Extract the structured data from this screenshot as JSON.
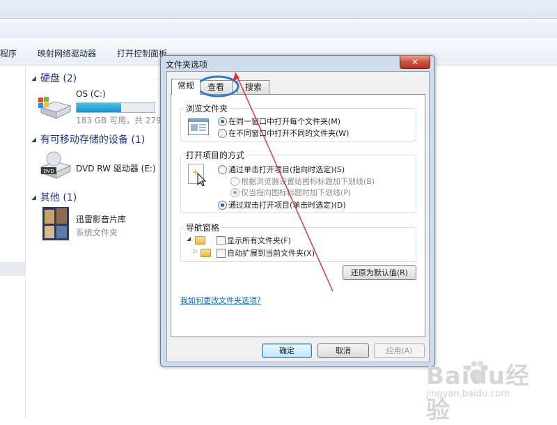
{
  "toolbar": {
    "item1": "程序",
    "item2": "映射网络驱动器",
    "item3": "打开控制面板"
  },
  "groups": {
    "hdd": {
      "label": "硬盘 (2)"
    },
    "removable": {
      "label": "有可移动存储的设备 (1)"
    },
    "other": {
      "label": "其他 (1)"
    }
  },
  "drives": {
    "os": {
      "name": "OS (C:)",
      "usage": "183 GB 可用，共 279",
      "fill_percent": 57
    },
    "dvd": {
      "name": "DVD RW 驱动器 (E:)",
      "icon_label": "DVD"
    },
    "media": {
      "name": "迅雷影音片库",
      "type": "系统文件夹"
    }
  },
  "dialog": {
    "title": "文件夹选项",
    "close": "✕",
    "tabs": [
      "常规",
      "查看",
      "搜索"
    ],
    "browse": {
      "legend": "浏览文件夹",
      "opt1": "在同一窗口中打开每个文件夹(M)",
      "opt2": "在不同窗口中打开不同的文件夹(W)"
    },
    "open": {
      "legend": "打开项目的方式",
      "opt1": "通过单击打开项目(指向时选定)(S)",
      "sub1": "根据浏览器设置给图标标题加下划线(B)",
      "sub2": "仅当指向图标标题时加下划线(P)",
      "opt2": "通过双击打开项目(单击时选定)(D)"
    },
    "nav": {
      "legend": "导航窗格",
      "chk1": "显示所有文件夹(F)",
      "chk2": "自动扩展到当前文件夹(X)"
    },
    "restore_btn": "还原为默认值(R)",
    "help_link": "我如何更改文件夹选项?",
    "ok_btn": "确定",
    "cancel_btn": "取消",
    "apply_btn": "应用(A)"
  },
  "watermark": {
    "brand": "Baidu经验",
    "url": "jingyan.baidu.com"
  },
  "colors": {
    "annotation_red": "#d9383a",
    "annotation_blue": "#2f7fc4",
    "link": "#0f64b7"
  }
}
